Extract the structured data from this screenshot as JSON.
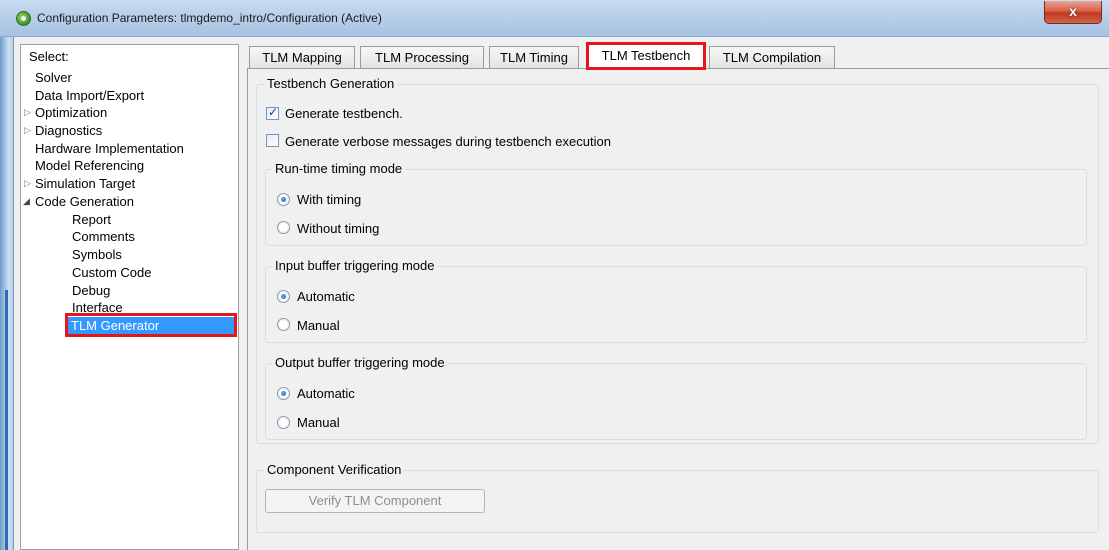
{
  "window": {
    "title": "Configuration Parameters: tlmgdemo_intro/Configuration (Active)",
    "close_label": "x"
  },
  "tree": {
    "header": "Select:",
    "items": [
      {
        "label": "Solver",
        "expander": ""
      },
      {
        "label": "Data Import/Export",
        "expander": ""
      },
      {
        "label": "Optimization",
        "expander": "collapsed"
      },
      {
        "label": "Diagnostics",
        "expander": "collapsed"
      },
      {
        "label": "Hardware Implementation",
        "expander": ""
      },
      {
        "label": "Model Referencing",
        "expander": ""
      },
      {
        "label": "Simulation Target",
        "expander": "collapsed"
      },
      {
        "label": "Code Generation",
        "expander": "expanded"
      },
      {
        "label": "Report",
        "expander": ""
      },
      {
        "label": "Comments",
        "expander": ""
      },
      {
        "label": "Symbols",
        "expander": ""
      },
      {
        "label": "Custom Code",
        "expander": ""
      },
      {
        "label": "Debug",
        "expander": ""
      },
      {
        "label": "Interface",
        "expander": ""
      },
      {
        "label": "TLM Generator",
        "expander": "",
        "selected": true
      }
    ]
  },
  "tabs": [
    {
      "label": "TLM Mapping"
    },
    {
      "label": "TLM Processing"
    },
    {
      "label": "TLM Timing"
    },
    {
      "label": "TLM Testbench",
      "active": true
    },
    {
      "label": "TLM Compilation"
    }
  ],
  "testbench": {
    "group_title": "Testbench Generation",
    "generate_testbench": {
      "label": "Generate testbench.",
      "checked": true
    },
    "verbose_messages": {
      "label": "Generate verbose messages during testbench execution",
      "checked": false
    },
    "runtime_timing": {
      "title": "Run-time timing mode",
      "options": [
        "With timing",
        "Without timing"
      ],
      "selected": "With timing"
    },
    "input_buffer": {
      "title": "Input buffer triggering mode",
      "options": [
        "Automatic",
        "Manual"
      ],
      "selected": "Automatic"
    },
    "output_buffer": {
      "title": "Output buffer triggering mode",
      "options": [
        "Automatic",
        "Manual"
      ],
      "selected": "Automatic"
    }
  },
  "verification": {
    "group_title": "Component Verification",
    "button_label": "Verify TLM Component"
  },
  "colors": {
    "highlight": "#e8141c",
    "selection": "#3399ff"
  }
}
